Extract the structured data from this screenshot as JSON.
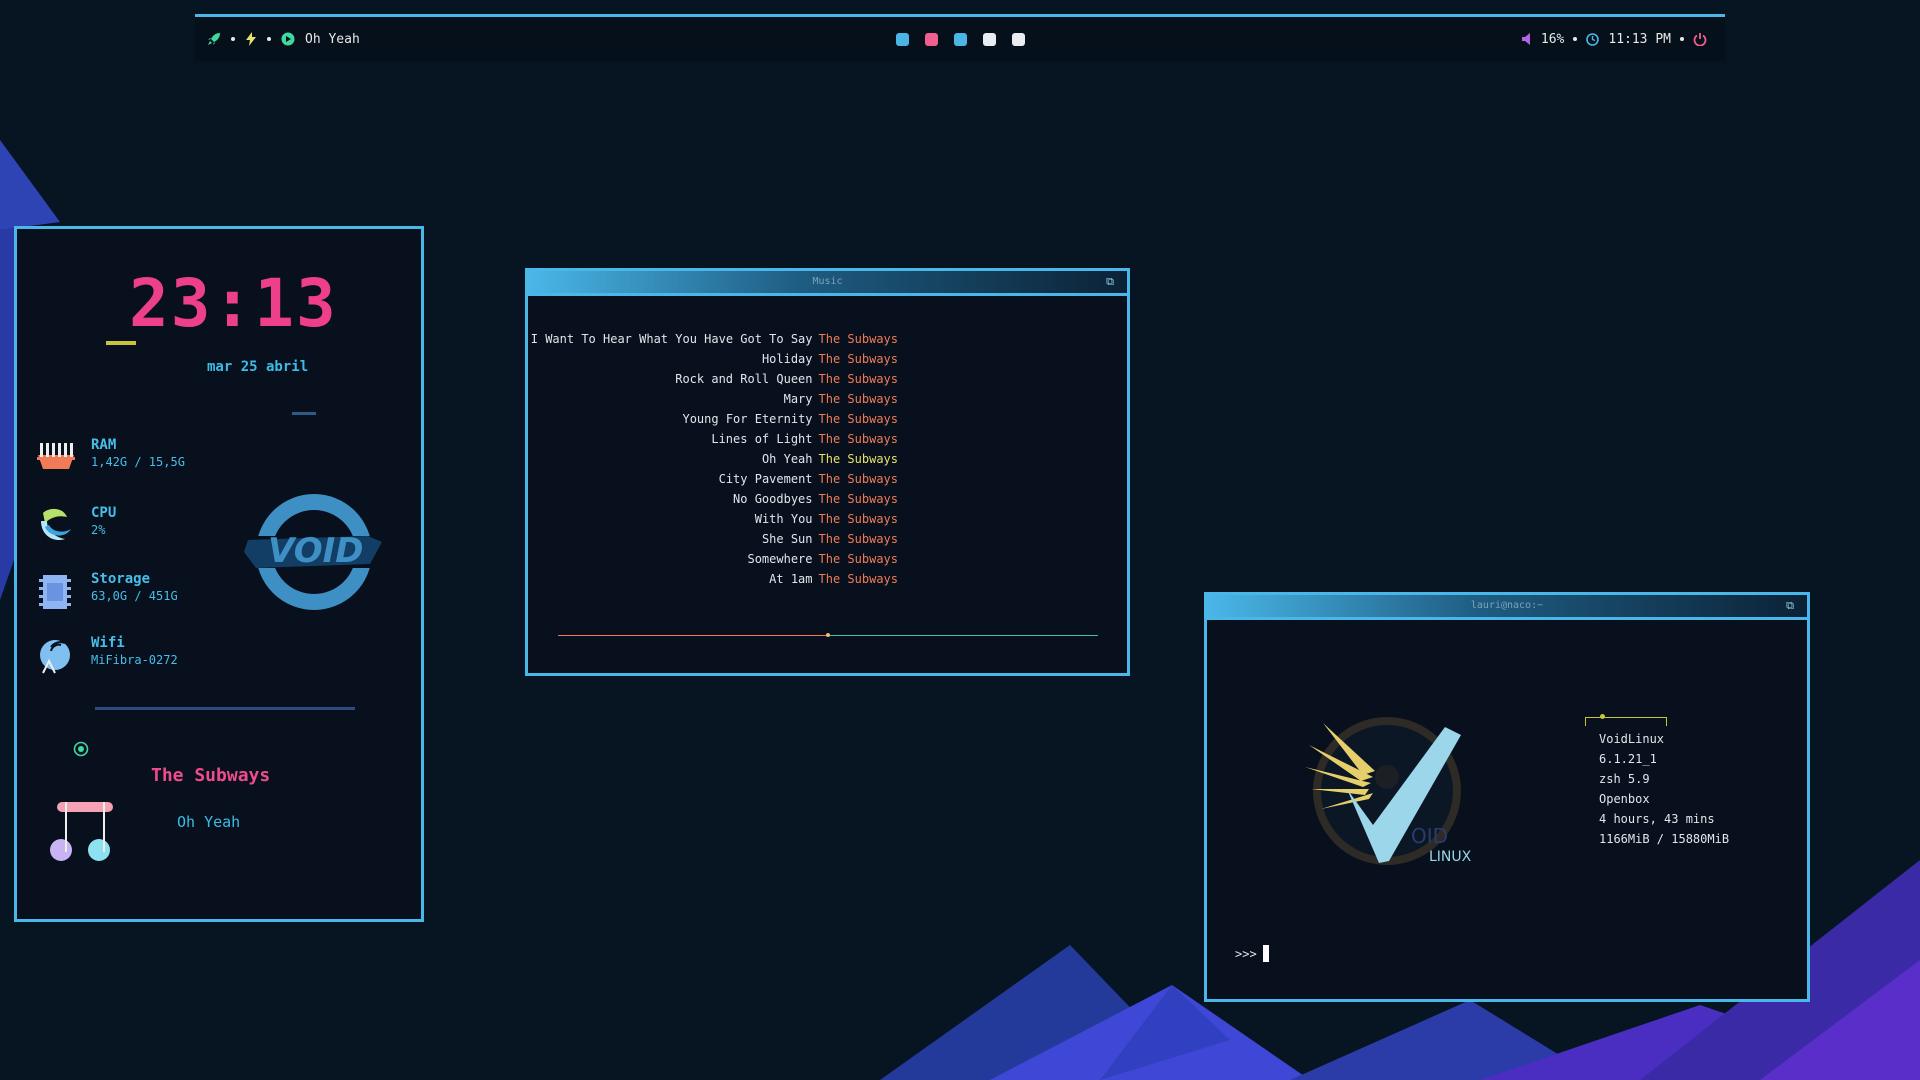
{
  "colors": {
    "accent": "#4ab7e8",
    "pink": "#ee3f8a",
    "orange": "#f07b56",
    "yellow": "#e6e26a",
    "background": "#071421"
  },
  "topbar": {
    "left": {
      "launcher_icon": "rocket-icon",
      "power_mode_icon": "lightning-icon",
      "player_icon": "play-circle-icon",
      "now_playing": "Oh Yeah"
    },
    "workspaces": [
      {
        "color": "#49b6e6"
      },
      {
        "color": "#ef5f8f"
      },
      {
        "color": "#49b6e6"
      },
      {
        "color": "#e9edf2"
      },
      {
        "color": "#e9edf2"
      }
    ],
    "right": {
      "volume_icon": "speaker-icon",
      "volume": "16%",
      "clock_icon": "clock-icon",
      "time": "11:13 PM",
      "power_icon": "power-icon"
    }
  },
  "widget": {
    "clock": "23:13",
    "date": "mar 25 abril",
    "stats": [
      {
        "icon": "ram-icon",
        "title": "RAM",
        "value": "1,42G / 15,5G"
      },
      {
        "icon": "cpu-icon",
        "title": "CPU",
        "value": "2%"
      },
      {
        "icon": "storage-icon",
        "title": "Storage",
        "value": "63,0G / 451G"
      },
      {
        "icon": "wifi-icon",
        "title": "Wifi",
        "value": "MiFibra-0272"
      }
    ],
    "logo_icon": "void-logo-icon",
    "artist": "The Subways",
    "song": "Oh Yeah"
  },
  "music_window": {
    "title": "Music",
    "tracks": [
      {
        "title": "I Want To Hear What You Have Got To Say",
        "artist": "The Subways"
      },
      {
        "title": "Holiday",
        "artist": "The Subways"
      },
      {
        "title": "Rock and Roll Queen",
        "artist": "The Subways"
      },
      {
        "title": "Mary",
        "artist": "The Subways"
      },
      {
        "title": "Young For Eternity",
        "artist": "The Subways"
      },
      {
        "title": "Lines of Light",
        "artist": "The Subways"
      },
      {
        "title": "Oh Yeah",
        "artist": "The Subways"
      },
      {
        "title": "City Pavement",
        "artist": "The Subways"
      },
      {
        "title": "No Goodbyes",
        "artist": "The Subways"
      },
      {
        "title": "With You",
        "artist": "The Subways"
      },
      {
        "title": "She Sun",
        "artist": "The Subways"
      },
      {
        "title": "Somewhere",
        "artist": "The Subways"
      },
      {
        "title": "At 1am",
        "artist": "The Subways"
      }
    ],
    "current_track_index": 6,
    "progress": 0.5
  },
  "terminal": {
    "title": "lauri@naco:~",
    "logo_text_void": "OID",
    "logo_text_linux": "LINUX",
    "fetch": [
      "VoidLinux",
      "6.1.21_1",
      "zsh 5.9",
      "Openbox",
      "4 hours, 43 mins",
      "1166MiB / 15880MiB"
    ],
    "prompt": ">>>"
  }
}
